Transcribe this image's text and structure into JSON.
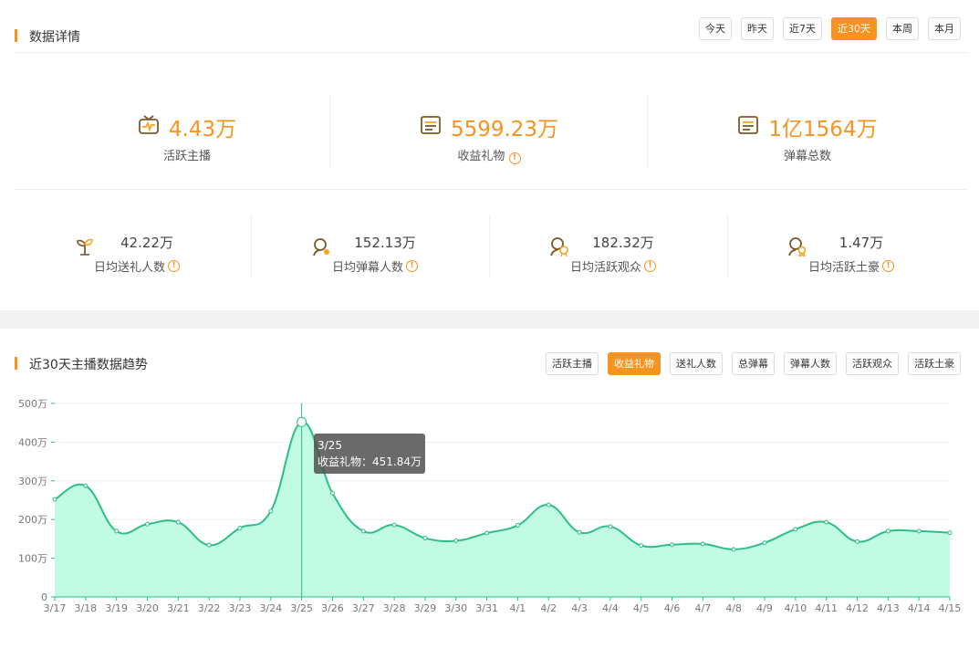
{
  "detail": {
    "title": "数据详情",
    "range_buttons": [
      {
        "label": "今天",
        "active": false
      },
      {
        "label": "昨天",
        "active": false
      },
      {
        "label": "近7天",
        "active": false
      },
      {
        "label": "近30天",
        "active": true
      },
      {
        "label": "本周",
        "active": false
      },
      {
        "label": "本月",
        "active": false
      }
    ],
    "big_stats": [
      {
        "value": "4.43万",
        "label": "活跃主播",
        "icon": "tv-icon",
        "warn": false
      },
      {
        "value": "5599.23万",
        "label": "收益礼物",
        "icon": "list-icon",
        "warn": true
      },
      {
        "value": "1亿1564万",
        "label": "弹幕总数",
        "icon": "list-icon",
        "warn": false
      }
    ],
    "small_stats": [
      {
        "value": "42.22万",
        "label": "日均送礼人数",
        "icon": "sprout-icon"
      },
      {
        "value": "152.13万",
        "label": "日均弹幕人数",
        "icon": "user-icon"
      },
      {
        "value": "182.32万",
        "label": "日均活跃观众",
        "icon": "viewer-icon"
      },
      {
        "value": "1.47万",
        "label": "日均活跃土豪",
        "icon": "medal-icon"
      }
    ],
    "warn_glyph": "!"
  },
  "trend": {
    "title": "近30天主播数据趋势",
    "metric_buttons": [
      {
        "label": "活跃主播",
        "active": false
      },
      {
        "label": "收益礼物",
        "active": true
      },
      {
        "label": "送礼人数",
        "active": false
      },
      {
        "label": "总弹幕",
        "active": false
      },
      {
        "label": "弹幕人数",
        "active": false
      },
      {
        "label": "活跃观众",
        "active": false
      },
      {
        "label": "活跃土豪",
        "active": false
      }
    ],
    "tooltip": {
      "date": "3/25",
      "text": "收益礼物：451.84万"
    }
  },
  "chart_data": {
    "type": "area",
    "x": [
      "3/17",
      "3/18",
      "3/19",
      "3/20",
      "3/21",
      "3/22",
      "3/23",
      "3/24",
      "3/25",
      "3/26",
      "3/27",
      "3/28",
      "3/29",
      "3/30",
      "3/31",
      "4/1",
      "4/2",
      "4/3",
      "4/4",
      "4/5",
      "4/6",
      "4/7",
      "4/8",
      "4/9",
      "4/10",
      "4/11",
      "4/12",
      "4/13",
      "4/14",
      "4/15"
    ],
    "series": [
      {
        "values": [
          252,
          287,
          170,
          188,
          193,
          134,
          178,
          222,
          451.84,
          268,
          170,
          186,
          152,
          145,
          165,
          185,
          238,
          167,
          182,
          133,
          135,
          137,
          123,
          140,
          175,
          193,
          143,
          170,
          170,
          166
        ],
        "color": "#2dbd87",
        "fill": "#c2fbe4"
      }
    ],
    "yticks": [
      "0",
      "100万",
      "200万",
      "300万",
      "400万",
      "500万"
    ],
    "ylim": [
      0,
      500
    ],
    "grid": true,
    "highlight_index": 8
  }
}
